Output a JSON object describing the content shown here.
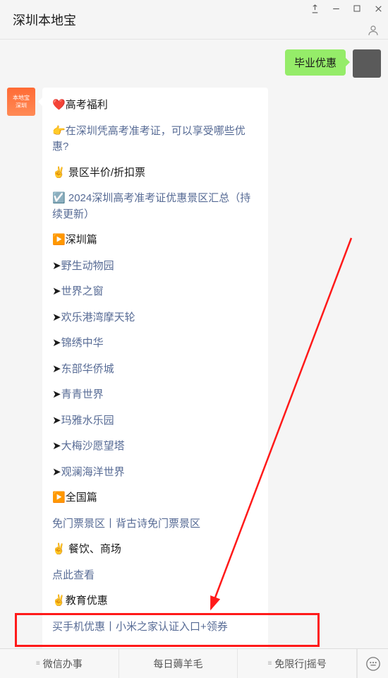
{
  "window": {
    "title": "深圳本地宝"
  },
  "outgoing": {
    "text": "毕业优惠"
  },
  "article": {
    "rows": [
      {
        "icon": "❤️",
        "text": "高考福利",
        "type": "heading"
      },
      {
        "icon": "👉",
        "text": "在深圳凭高考准考证，可以享受哪些优惠?",
        "type": "link"
      },
      {
        "icon": "✌️",
        "text": " 景区半价/折扣票",
        "type": "heading"
      },
      {
        "icon": "☑️",
        "text": " 2024深圳高考准考证优惠景区汇总（持续更新）",
        "type": "link"
      },
      {
        "icon": "▶️",
        "text": "深圳篇",
        "type": "heading"
      },
      {
        "icon": "➤",
        "text": "野生动物园",
        "type": "link"
      },
      {
        "icon": "➤",
        "text": "世界之窗",
        "type": "link"
      },
      {
        "icon": "➤",
        "text": "欢乐港湾摩天轮",
        "type": "link"
      },
      {
        "icon": "➤",
        "text": "锦绣中华",
        "type": "link"
      },
      {
        "icon": "➤",
        "text": "东部华侨城",
        "type": "link"
      },
      {
        "icon": "➤",
        "text": "青青世界",
        "type": "link"
      },
      {
        "icon": "➤",
        "text": "玛雅水乐园",
        "type": "link"
      },
      {
        "icon": "➤",
        "text": "大梅沙愿望塔",
        "type": "link"
      },
      {
        "icon": "➤",
        "text": "观澜海洋世界",
        "type": "link"
      },
      {
        "icon": "▶️",
        "text": "全国篇",
        "type": "heading"
      },
      {
        "icon": "",
        "text": "免门票景区丨背古诗免门票景区",
        "type": "link"
      },
      {
        "icon": "✌️",
        "text": " 餐饮、商场",
        "type": "heading"
      },
      {
        "icon": "",
        "text": "点此查看",
        "type": "link"
      },
      {
        "icon": "✌️",
        "text": "教育优惠",
        "type": "heading"
      },
      {
        "icon": "",
        "text": "买手机优惠丨小米之家认证入口+领券",
        "type": "link"
      }
    ]
  },
  "tabs": {
    "t1": "微信办事",
    "t2": "每日薅羊毛",
    "t3": "免限行|摇号"
  }
}
